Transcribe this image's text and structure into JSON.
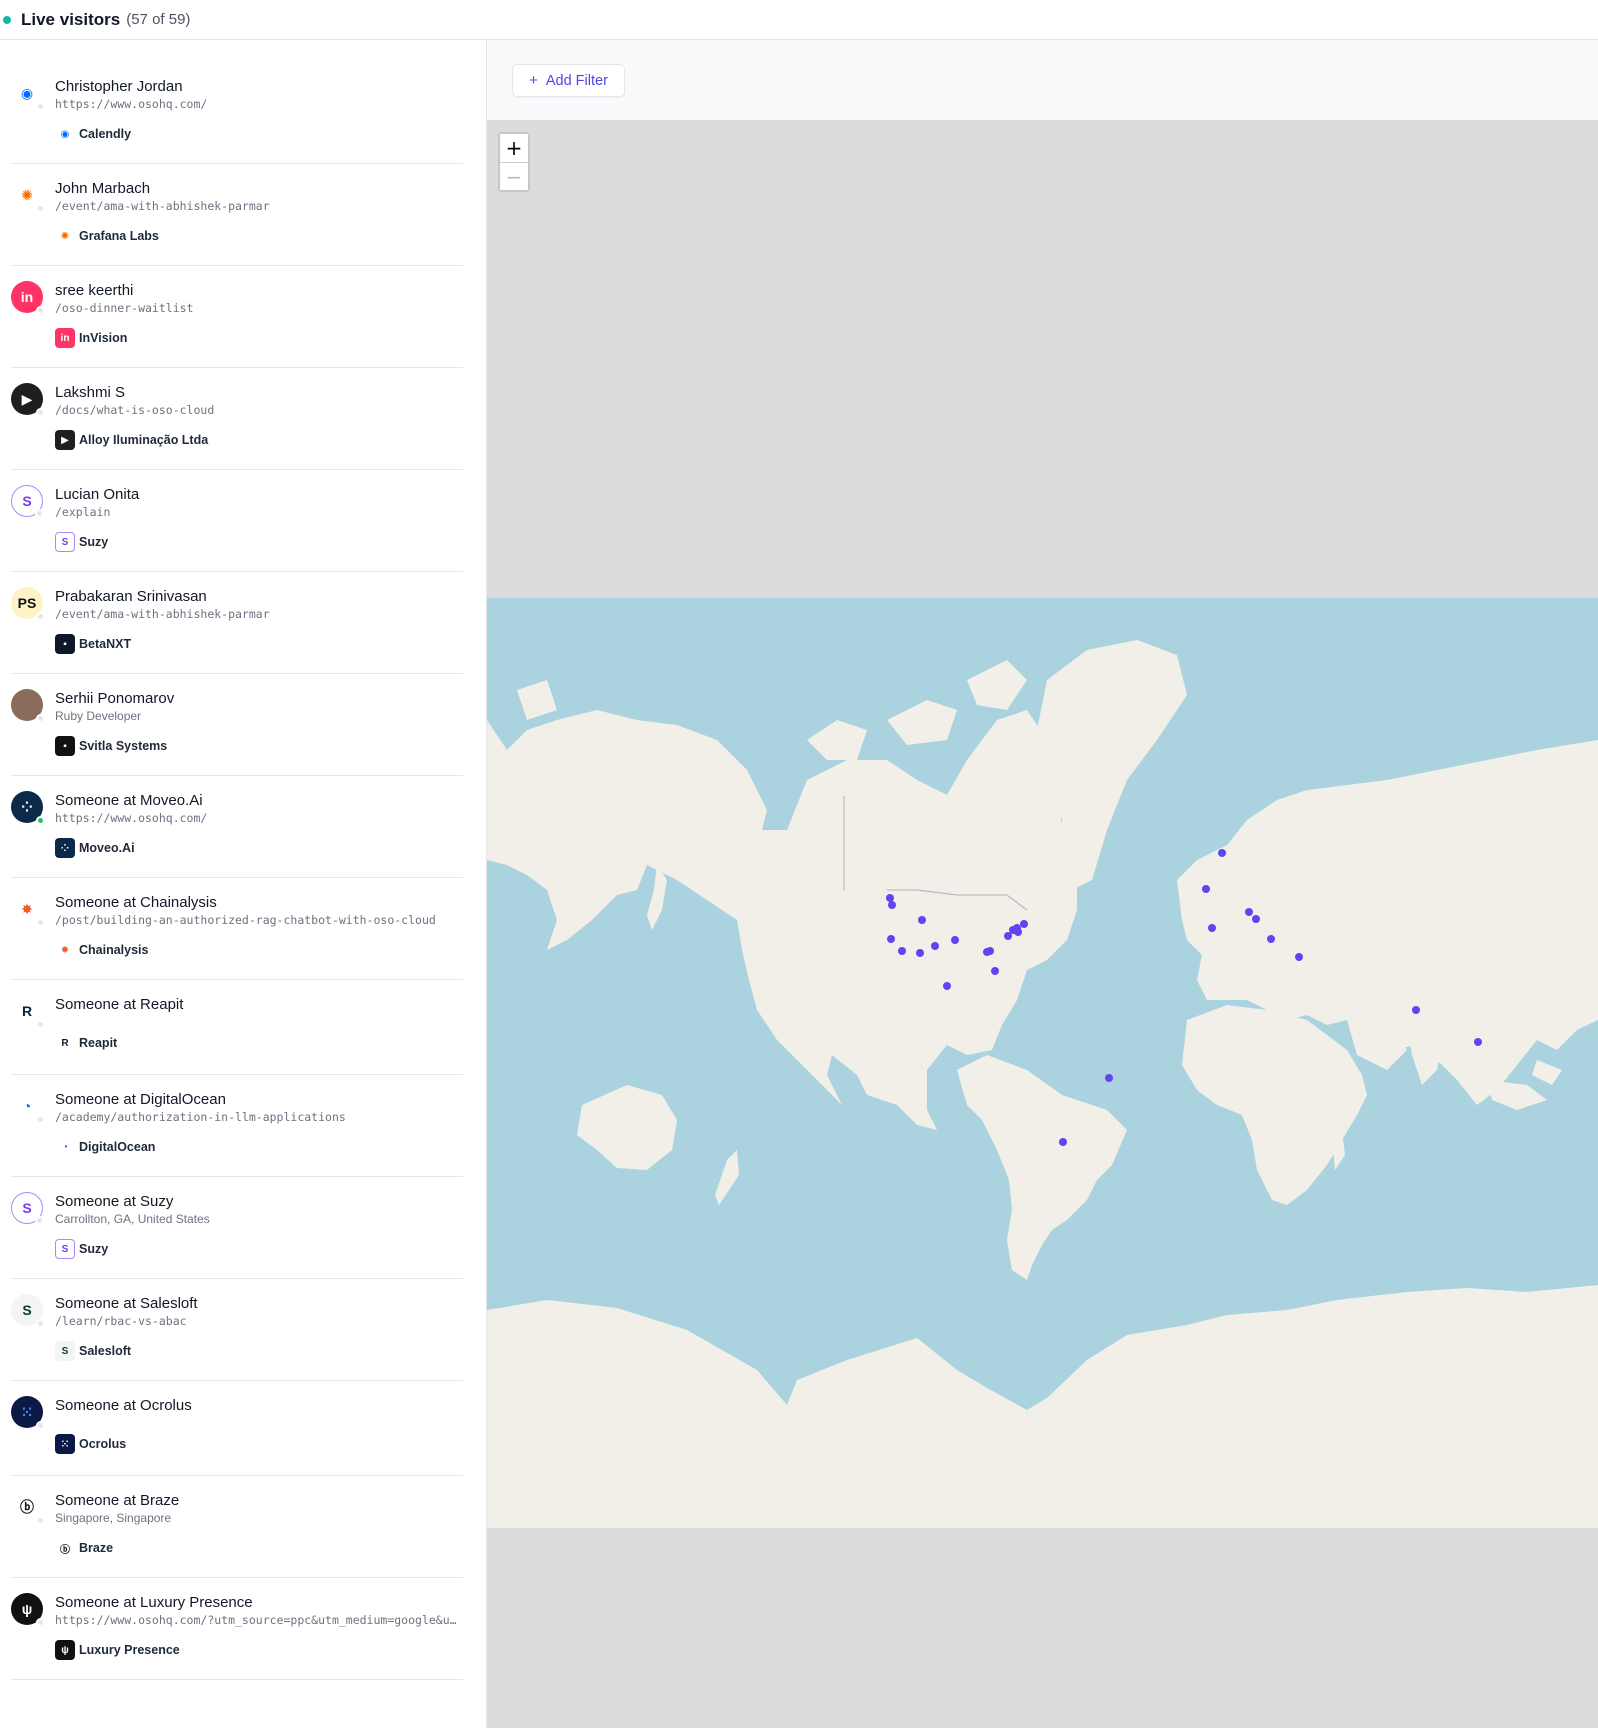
{
  "header": {
    "title": "Live visitors",
    "count_text": "(57 of 59)"
  },
  "filters": {
    "add_label": "Add Filter",
    "add_icon": "+"
  },
  "map": {
    "zoom_in": "+",
    "zoom_out": "−",
    "ocean_color": "#aad3df",
    "land_color": "#f2efe9",
    "marker_color": "#6243f2"
  },
  "visitors": [
    {
      "name": "Christopher Jordan",
      "sub": "https://www.osohq.com/",
      "mono": true,
      "company": "Calendly",
      "online": false
    },
    {
      "name": "John Marbach",
      "sub": "/event/ama-with-abhishek-parmar",
      "mono": true,
      "company": "Grafana Labs",
      "online": false
    },
    {
      "name": "sree keerthi",
      "sub": "/oso-dinner-waitlist",
      "mono": true,
      "company": "InVision",
      "online": false
    },
    {
      "name": "Lakshmi S",
      "sub": "/docs/what-is-oso-cloud",
      "mono": true,
      "company": "Alloy Iluminação Ltda",
      "online": false
    },
    {
      "name": "Lucian Onita",
      "sub": "/explain",
      "mono": true,
      "company": "Suzy",
      "online": false
    },
    {
      "name": "Prabakaran Srinivasan",
      "initials": "PS",
      "sub": "/event/ama-with-abhishek-parmar",
      "mono": true,
      "company": "BetaNXT",
      "online": false
    },
    {
      "name": "Serhii Ponomarov",
      "sub": "Ruby Developer",
      "mono": false,
      "company": "Svitla Systems",
      "online": false
    },
    {
      "name": "Someone at Moveo.Ai",
      "sub": "https://www.osohq.com/",
      "mono": true,
      "company": "Moveo.Ai",
      "online": true
    },
    {
      "name": "Someone at Chainalysis",
      "sub": "/post/building-an-authorized-rag-chatbot-with-oso-cloud",
      "mono": true,
      "company": "Chainalysis",
      "online": false
    },
    {
      "name": "Someone at Reapit",
      "sub": "",
      "mono": false,
      "company": "Reapit",
      "online": false
    },
    {
      "name": "Someone at DigitalOcean",
      "sub": "/academy/authorization-in-llm-applications",
      "mono": true,
      "company": "DigitalOcean",
      "online": false
    },
    {
      "name": "Someone at Suzy",
      "sub": "Carrollton, GA, United States",
      "mono": false,
      "company": "Suzy",
      "online": false
    },
    {
      "name": "Someone at Salesloft",
      "sub": "/learn/rbac-vs-abac",
      "mono": true,
      "company": "Salesloft",
      "online": false
    },
    {
      "name": "Someone at Ocrolus",
      "sub": "",
      "mono": false,
      "company": "Ocrolus",
      "online": false
    },
    {
      "name": "Someone at Braze",
      "sub": "Singapore, Singapore",
      "mono": false,
      "company": "Braze",
      "online": false
    },
    {
      "name": "Someone at Luxury Presence",
      "sub": "https://www.osohq.com/?utm_source=ppc&utm_medium=google&utm_campaign=brand",
      "mono": true,
      "company": "Luxury Presence",
      "online": false
    }
  ]
}
